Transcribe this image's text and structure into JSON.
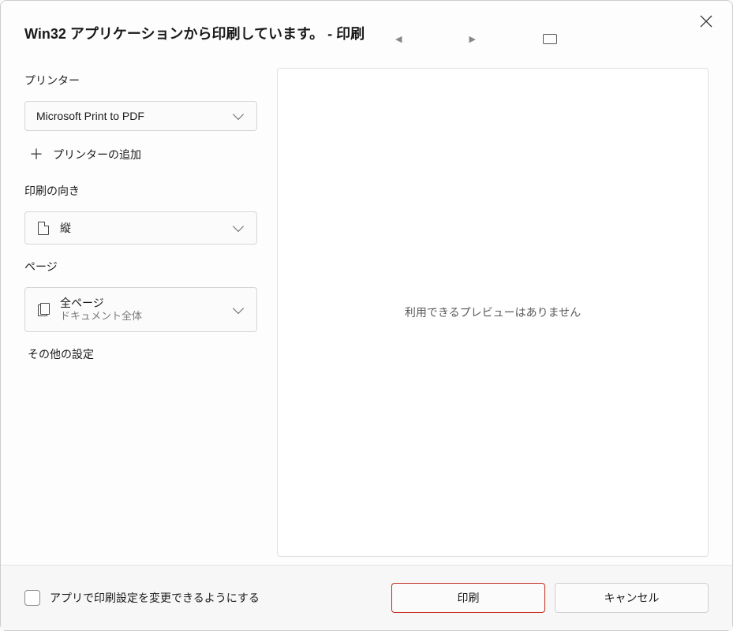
{
  "header": {
    "title": "Win32 アプリケーションから印刷しています。 - 印刷"
  },
  "printer": {
    "label": "プリンター",
    "selected": "Microsoft Print to PDF",
    "add_label": "プリンターの追加"
  },
  "orientation": {
    "label": "印刷の向き",
    "selected": "縦"
  },
  "pages": {
    "label": "ページ",
    "selected": "全ページ",
    "subtitle": "ドキュメント全体"
  },
  "more_settings": "その他の設定",
  "preview": {
    "empty_message": "利用できるプレビューはありません"
  },
  "footer": {
    "checkbox_label": "アプリで印刷設定を変更できるようにする",
    "print_label": "印刷",
    "cancel_label": "キャンセル"
  }
}
